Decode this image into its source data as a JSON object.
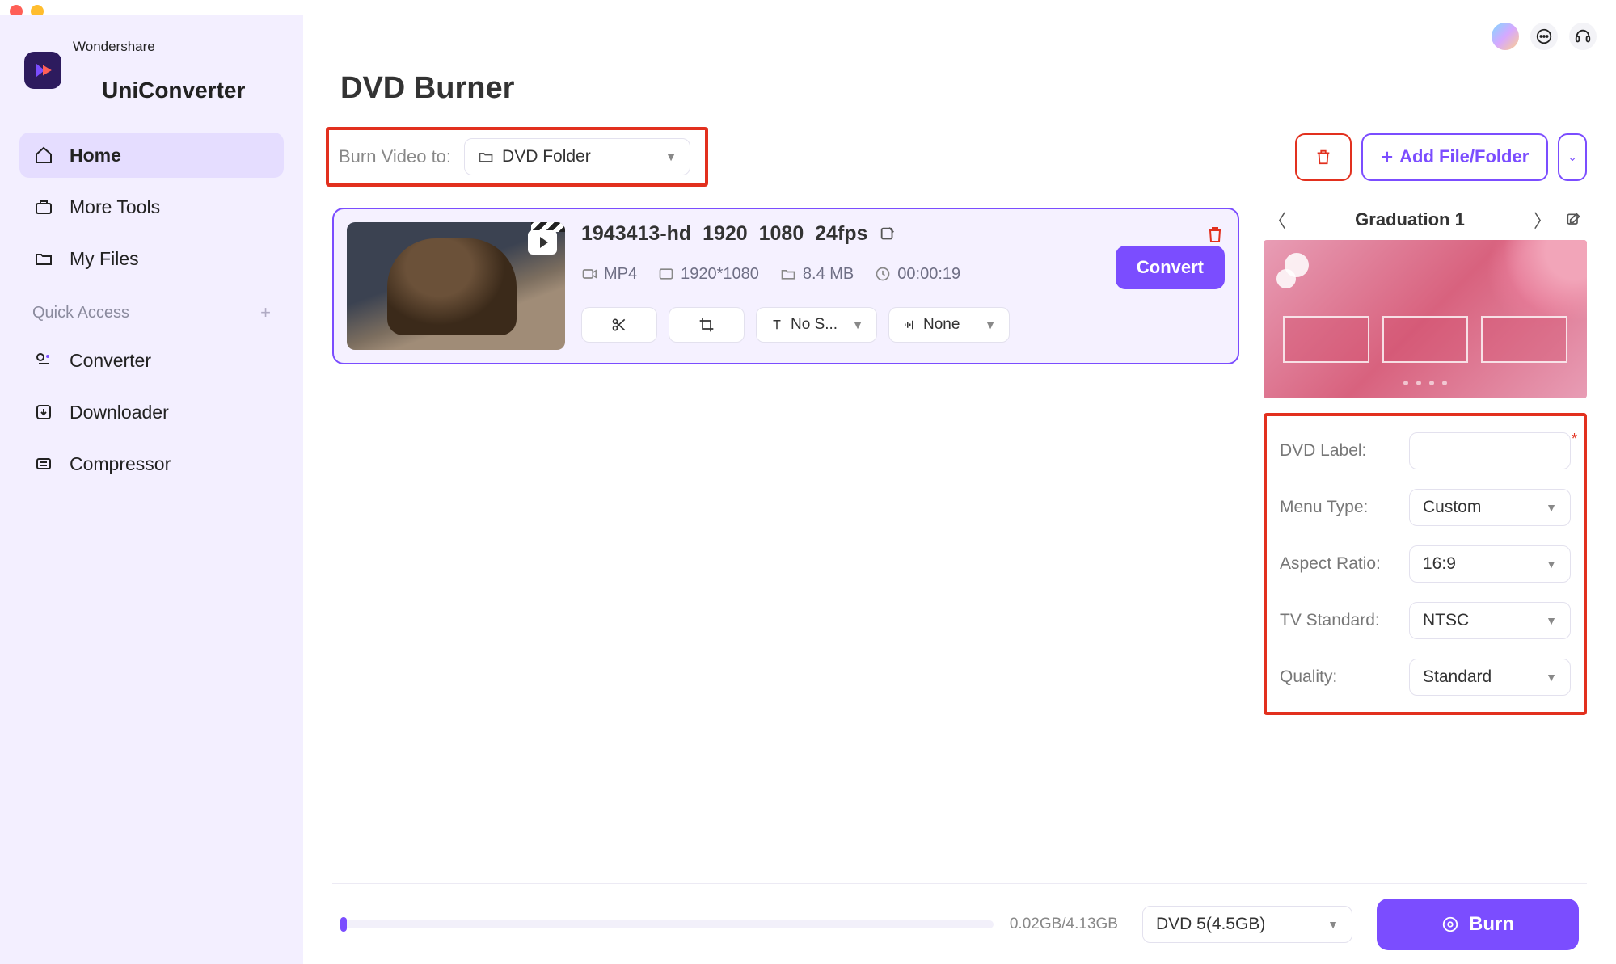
{
  "brand": {
    "sup": "Wondershare",
    "main": "UniConverter"
  },
  "sidebar": {
    "nav": [
      {
        "label": "Home",
        "active": true
      },
      {
        "label": "More Tools"
      },
      {
        "label": "My Files"
      }
    ],
    "quick_label": "Quick Access",
    "quick": [
      {
        "label": "Converter"
      },
      {
        "label": "Downloader"
      },
      {
        "label": "Compressor"
      }
    ]
  },
  "page": {
    "title": "DVD Burner"
  },
  "burn_target": {
    "label": "Burn Video to:",
    "value": "DVD Folder"
  },
  "actions": {
    "add": "Add File/Folder"
  },
  "file": {
    "name": "1943413-hd_1920_1080_24fps",
    "format": "MP4",
    "resolution": "1920*1080",
    "size": "8.4 MB",
    "duration": "00:00:19",
    "convert": "Convert",
    "subtitle": "No S...",
    "audio": "None"
  },
  "template": {
    "name": "Graduation 1"
  },
  "settings": {
    "dvd_label": {
      "label": "DVD Label:",
      "value": ""
    },
    "menu_type": {
      "label": "Menu Type:",
      "value": "Custom"
    },
    "aspect": {
      "label": "Aspect Ratio:",
      "value": "16:9"
    },
    "tv": {
      "label": "TV Standard:",
      "value": "NTSC"
    },
    "quality": {
      "label": "Quality:",
      "value": "Standard"
    }
  },
  "footer": {
    "usage": "0.02GB/4.13GB",
    "disc": "DVD 5(4.5GB)",
    "burn": "Burn"
  }
}
